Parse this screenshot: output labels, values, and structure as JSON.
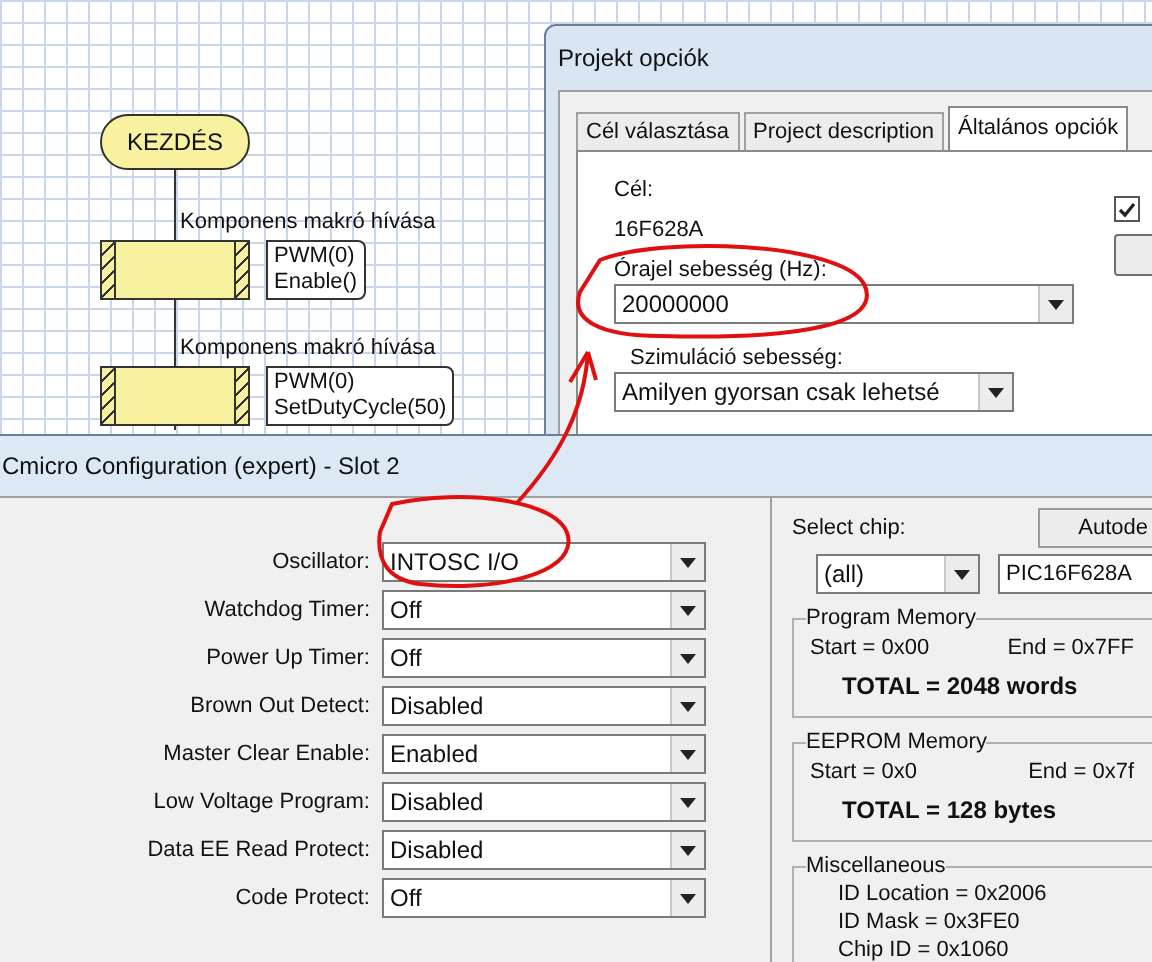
{
  "flowchart": {
    "start": "KEZDÉS",
    "steps": [
      {
        "label": "Komponens makró hívása",
        "comment": [
          "PWM(0)",
          "Enable()"
        ]
      },
      {
        "label": "Komponens makró hívása",
        "comment": [
          "PWM(0)",
          "SetDutyCycle(50)"
        ]
      }
    ]
  },
  "project_options": {
    "title": "Projekt opciók",
    "tabs": [
      {
        "label": "Cél választása",
        "selected": false
      },
      {
        "label": "Project description",
        "selected": false
      },
      {
        "label": "Általános opciók",
        "selected": true
      }
    ],
    "target_label": "Cél:",
    "target": "16F628A",
    "clock_label": "Órajel sebesség (Hz):",
    "clock_value": "20000000",
    "sim_label": "Szimuláció sebesség:",
    "sim_value": "Amilyen gyorsan csak lehetsé",
    "checkbox": {
      "checked": true
    }
  },
  "config": {
    "title": "Cmicro Configuration (expert) - Slot 2",
    "settings": [
      {
        "label": "Oscillator:",
        "value": "INTOSC I/O"
      },
      {
        "label": "Watchdog Timer:",
        "value": "Off"
      },
      {
        "label": "Power Up Timer:",
        "value": "Off"
      },
      {
        "label": "Brown Out Detect:",
        "value": "Disabled"
      },
      {
        "label": "Master Clear Enable:",
        "value": "Enabled"
      },
      {
        "label": "Low Voltage Program:",
        "value": "Disabled"
      },
      {
        "label": "Data EE Read Protect:",
        "value": "Disabled"
      },
      {
        "label": "Code Protect:",
        "value": "Off"
      }
    ],
    "select_chip_label": "Select chip:",
    "autodetect": "Autode",
    "family": "(all)",
    "chip": "PIC16F628A",
    "groups": [
      {
        "title": "Program Memory",
        "start": "Start = 0x00",
        "end": "End = 0x7FF",
        "total": "TOTAL = 2048 words"
      },
      {
        "title": "EEPROM Memory",
        "start": "Start = 0x0",
        "end": "End = 0x7f",
        "total": "TOTAL = 128 bytes"
      }
    ],
    "misc": {
      "title": "Miscellaneous",
      "lines": [
        "ID Location = 0x2006",
        "ID Mask = 0x3FE0",
        "Chip ID = 0x1060"
      ]
    }
  }
}
